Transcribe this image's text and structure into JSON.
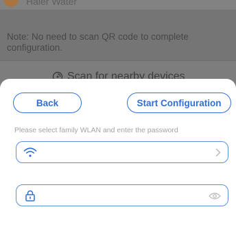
{
  "background": {
    "top_title": "Haier Water",
    "note": "Note: No need to scan QR code to complete configuration.",
    "scan_label": "Scan for nearby devices"
  },
  "sheet": {
    "back_label": "Back",
    "start_label": "Start Configuration",
    "instruction": "Please select family WLAN and enter the password",
    "wifi_field": {
      "value": "",
      "lead_icon": "wifi-icon",
      "trail_icon": "chevron-right-icon"
    },
    "password_field": {
      "value": "",
      "lead_icon": "lock-icon",
      "trail_icon": "eye-icon"
    }
  },
  "colors": {
    "accent": "#2f6fd6",
    "field_border": "#5e8fd9",
    "overlay": "#7a7a7a"
  }
}
